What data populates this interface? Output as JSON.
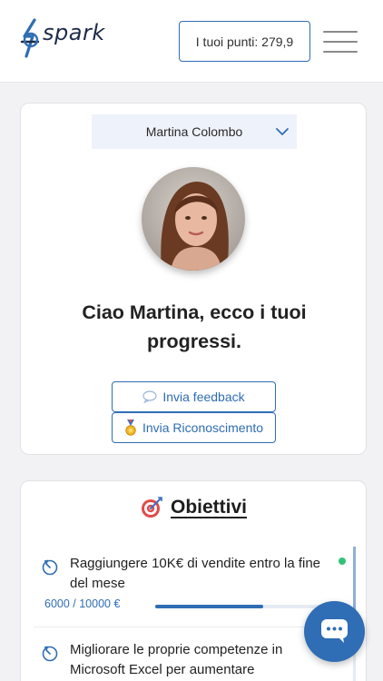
{
  "header": {
    "logo_text": "spark",
    "points_label": "I tuoi punti: 279,9",
    "menu_icon": "hamburger-menu-icon"
  },
  "profile": {
    "selected_user": "Martina Colombo",
    "greeting": "Ciao Martina, ecco i tuoi progressi.",
    "feedback_button": "Invia feedback",
    "recognition_button": "Invia Riconoscimento",
    "feedback_icon": "speech-bubble-icon",
    "recognition_icon": "medal-icon"
  },
  "objectives": {
    "title": "Obiettivi",
    "title_icon": "target-icon",
    "items": [
      {
        "text": "Raggiungere 10K€ di vendite entro la fine del mese",
        "progress_label": "6000 / 10000 €",
        "progress_fraction": 0.58,
        "status": "active"
      },
      {
        "text": "Migliorare le proprie competenze in Microsoft Excel per aumentare"
      }
    ]
  },
  "chat": {
    "icon": "chat-icon"
  },
  "colors": {
    "accent": "#2f6db5",
    "status_dot": "#33c27a",
    "background": "#f2f2f4"
  }
}
